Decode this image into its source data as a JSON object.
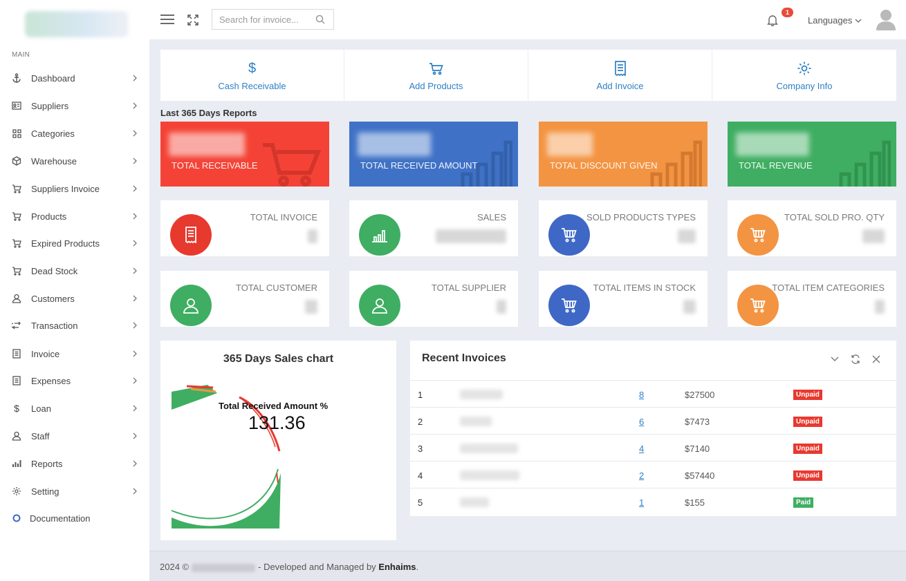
{
  "sidebar": {
    "section_label": "MAIN",
    "items": [
      {
        "label": "Dashboard",
        "icon": "anchor-icon"
      },
      {
        "label": "Suppliers",
        "icon": "id-card-icon"
      },
      {
        "label": "Categories",
        "icon": "grid-icon"
      },
      {
        "label": "Warehouse",
        "icon": "cube-icon"
      },
      {
        "label": "Suppliers Invoice",
        "icon": "cart-icon"
      },
      {
        "label": "Products",
        "icon": "cart-icon"
      },
      {
        "label": "Expired Products",
        "icon": "cart-icon"
      },
      {
        "label": "Dead Stock",
        "icon": "cart-icon"
      },
      {
        "label": "Customers",
        "icon": "user-icon"
      },
      {
        "label": "Transaction",
        "icon": "exchange-icon"
      },
      {
        "label": "Invoice",
        "icon": "document-icon"
      },
      {
        "label": "Expenses",
        "icon": "document-icon"
      },
      {
        "label": "Loan",
        "icon": "dollar-icon"
      },
      {
        "label": "Staff",
        "icon": "user-icon"
      },
      {
        "label": "Reports",
        "icon": "bar-chart-icon"
      },
      {
        "label": "Setting",
        "icon": "gear-icon"
      }
    ],
    "documentation_label": "Documentation"
  },
  "header": {
    "search_placeholder": "Search for invoice...",
    "notification_count": "1",
    "languages_label": "Languages"
  },
  "quick_actions": [
    {
      "label": "Cash Receivable",
      "icon": "dollar-icon"
    },
    {
      "label": "Add Products",
      "icon": "cart-icon"
    },
    {
      "label": "Add Invoice",
      "icon": "receipt-icon"
    },
    {
      "label": "Company Info",
      "icon": "gear-icon"
    }
  ],
  "reports_title": "Last 365 Days Reports",
  "stats": [
    {
      "label": "TOTAL RECEIVABLE",
      "color": "#f44336"
    },
    {
      "label": "TOTAL RECEIVED AMOUNT",
      "color": "#3f72c6"
    },
    {
      "label": "TOTAL DISCOUNT GIVEN",
      "color": "#f39442"
    },
    {
      "label": "TOTAL REVENUE",
      "color": "#3fae62"
    }
  ],
  "cards_row1": [
    {
      "label": "TOTAL INVOICE",
      "color": "#e8392f",
      "icon": "receipt-icon"
    },
    {
      "label": "SALES",
      "color": "#3fae62",
      "icon": "bar-chart-icon"
    },
    {
      "label": "SOLD PRODUCTS TYPES",
      "color": "#3f68c6",
      "icon": "cart-icon"
    },
    {
      "label": "TOTAL SOLD PRO. QTY",
      "color": "#f39442",
      "icon": "cart-icon"
    }
  ],
  "cards_row2": [
    {
      "label": "TOTAL CUSTOMER",
      "color": "#3fae62",
      "icon": "user-icon"
    },
    {
      "label": "TOTAL SUPPLIER",
      "color": "#3fae62",
      "icon": "user-icon"
    },
    {
      "label": "TOTAL ITEMS IN STOCK",
      "color": "#3f68c6",
      "icon": "cart-icon"
    },
    {
      "label": "TOTAL ITEM CATEGORIES",
      "color": "#f39442",
      "icon": "cart-icon"
    }
  ],
  "sales_chart": {
    "title": "365 Days Sales chart",
    "gauge_label": "Total Received Amount %",
    "gauge_value": "131.36"
  },
  "recent_invoices": {
    "title": "Recent Invoices",
    "rows": [
      {
        "num": "1",
        "link": "8",
        "amount": "$27500",
        "status": "Unpaid",
        "status_color": "#e8392f"
      },
      {
        "num": "2",
        "link": "6",
        "amount": "$7473",
        "status": "Unpaid",
        "status_color": "#e8392f"
      },
      {
        "num": "3",
        "link": "4",
        "amount": "$7140",
        "status": "Unpaid",
        "status_color": "#e8392f"
      },
      {
        "num": "4",
        "link": "2",
        "amount": "$57440",
        "status": "Unpaid",
        "status_color": "#e8392f"
      },
      {
        "num": "5",
        "link": "1",
        "amount": "$155",
        "status": "Paid",
        "status_color": "#3fae62"
      }
    ]
  },
  "footer": {
    "year": "2024 ©",
    "text": "- Developed and Managed by",
    "brand": "Enhaims",
    "period": "."
  }
}
